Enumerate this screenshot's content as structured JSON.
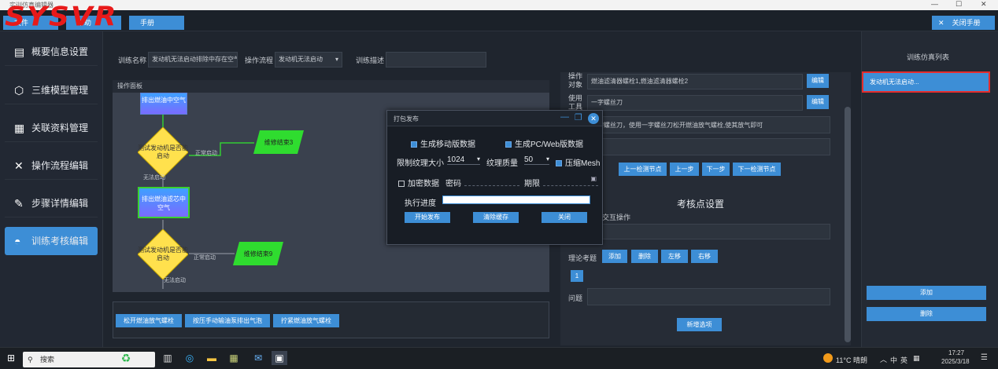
{
  "window": {
    "title": "实训仿真编辑器",
    "min": "—",
    "max": "☐",
    "close": "✕"
  },
  "logo": "SYSVR",
  "toolbar": {
    "btn1": "文件",
    "btn2": "帮助",
    "btn3": "手册",
    "close_manual": "关闭手册",
    "close_x": "✕"
  },
  "sidebar": {
    "items": [
      {
        "label": "概要信息设置",
        "icon": "clipboard-icon"
      },
      {
        "label": "三维模型管理",
        "icon": "cube-icon"
      },
      {
        "label": "关联资料管理",
        "icon": "document-icon"
      },
      {
        "label": "操作流程编辑",
        "icon": "tools-icon"
      },
      {
        "label": "步骤详情编辑",
        "icon": "edit-icon"
      },
      {
        "label": "训练考核编辑",
        "icon": "vr-icon"
      }
    ]
  },
  "form": {
    "name_label": "训练名称",
    "name_value": "发动机无法启动排除中存在空气",
    "flow_label": "操作流程",
    "flow_value": "发动机无法启动",
    "desc_label": "训练描述",
    "desc_value": ""
  },
  "flow": {
    "header": "操作面板",
    "node_top": "排出燃油中空气",
    "dec1": "测试发动机是否能启动",
    "end1": "维修结束3",
    "dec1_yes": "正常启动",
    "dec1_no": "无法启动",
    "proc2": "排出燃油滤芯中空气",
    "dec2": "测试发动机是否能启动",
    "end2": "维修结束9",
    "dec2_yes": "正常启动",
    "dec2_no": "无法启动"
  },
  "steps": {
    "btn1": "松开燃油放气螺栓",
    "btn2": "按压手动输油泵排出气泡",
    "btn3": "拧紧燃油放气螺栓"
  },
  "right": {
    "op_obj_label": "操作对象",
    "op_obj_value": "燃油滤清器螺栓1,燃油滤清器螺栓2",
    "edit1": "编辑",
    "tool_label": "使用工具",
    "tool_value": "一字螺丝刀",
    "edit2": "编辑",
    "desc_value": "一字螺丝刀，使用一字螺丝刀松开燃油放气螺栓,使其放气即可",
    "nav_prev_node": "上一检测节点",
    "nav_prev": "上一步",
    "nav_next": "下一步",
    "nav_next_node": "下一检测节点",
    "check_title": "考核点设置",
    "interact_label": "交互操作",
    "theory_label": "理论考题",
    "add": "添加",
    "delete": "删除",
    "left": "左移",
    "right": "右移",
    "page": "1",
    "question_label": "问题",
    "new_option": "新增选项"
  },
  "list": {
    "title": "训练仿真列表",
    "item": "发动机无法启动...",
    "add": "添加",
    "delete": "删除"
  },
  "dialog": {
    "title": "打包发布",
    "gen_mobile": "生成移动版数据",
    "gen_pc": "生成PC/Web版数据",
    "tex_limit_label": "限制纹理大小",
    "tex_limit_value": "1024",
    "tex_quality_label": "纹理质量",
    "tex_quality_value": "50",
    "compress_mesh": "压缩Mesh",
    "encrypt": "加密数据",
    "password_label": "密码",
    "expire_label": "期限",
    "progress_label": "执行进度",
    "progress": 0,
    "btn_start": "开始发布",
    "btn_clear": "清除缓存",
    "btn_close": "关闭"
  },
  "taskbar": {
    "search": "搜索",
    "weather": "11°C 晴朗",
    "ime": "中",
    "lang": "英",
    "time": "17:27",
    "date": "2025/3/18"
  }
}
